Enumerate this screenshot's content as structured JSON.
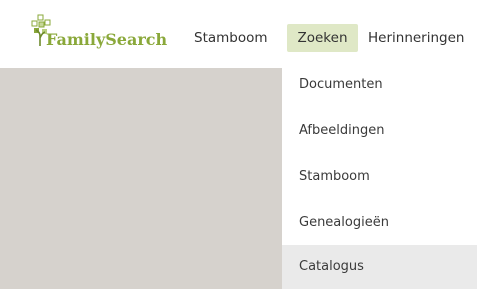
{
  "brand": {
    "name": "FamilySearch",
    "color": "#8aa83a",
    "icon": "tree-icon"
  },
  "nav": {
    "items": [
      {
        "label": "Stamboom"
      },
      {
        "label": "Zoeken",
        "active": true
      },
      {
        "label": "Herinneringen"
      }
    ],
    "active_bg": "#dfe8c6"
  },
  "dropdown": {
    "items": [
      {
        "label": "Documenten"
      },
      {
        "label": "Afbeeldingen"
      },
      {
        "label": "Stamboom"
      },
      {
        "label": "Genealogieën"
      },
      {
        "label": "Catalogus",
        "hovered": true
      }
    ]
  },
  "colors": {
    "panel_bg": "#d6d2cd",
    "hover_bg": "#eaeaea"
  }
}
